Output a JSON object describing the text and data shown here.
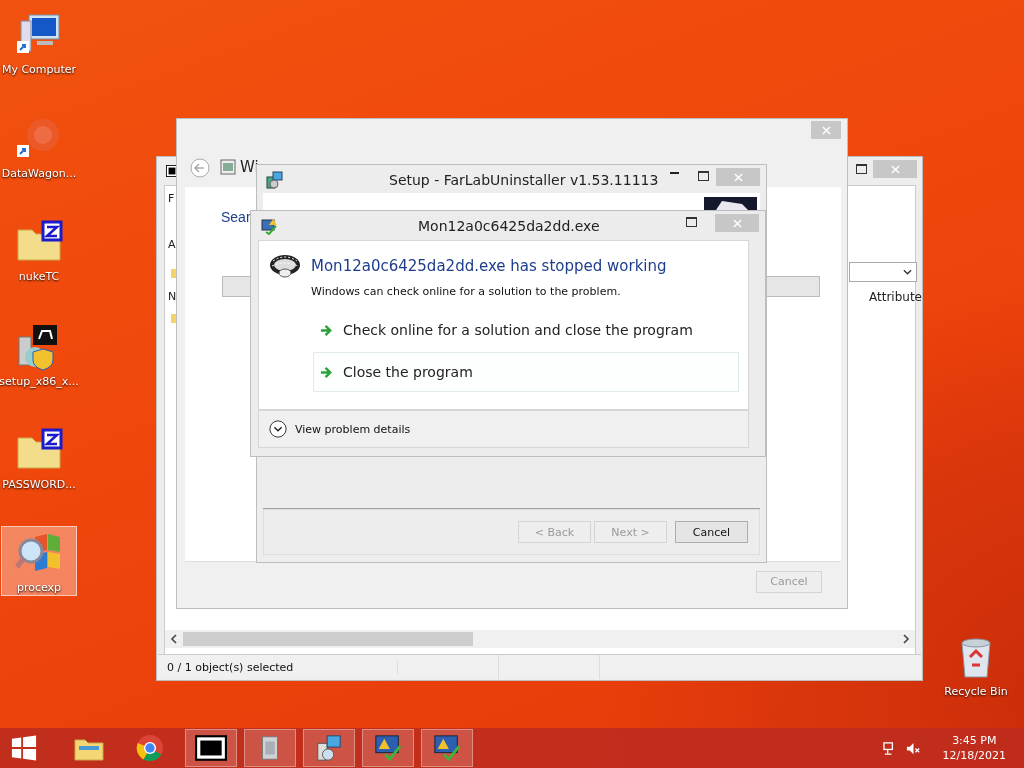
{
  "desktop_icons": [
    {
      "label": "My Computer",
      "kind": "computer",
      "selected": false
    },
    {
      "label": "DataWagon...",
      "kind": "blur",
      "selected": false
    },
    {
      "label": "nukeTC",
      "kind": "zipfolder",
      "selected": false
    },
    {
      "label": "setup_x86_x...",
      "kind": "installer",
      "selected": false
    },
    {
      "label": "PASSWORD...",
      "kind": "zipfolder",
      "selected": false
    },
    {
      "label": "procexp",
      "kind": "magnifier",
      "selected": true
    }
  ],
  "recycle_bin": {
    "label": "Recycle Bin"
  },
  "archive_window": {
    "menu_letter": "F",
    "address_letter": "A",
    "column_1": "N",
    "column_2": "Attribute",
    "status": "0 / 1 object(s) selected"
  },
  "features_window": {
    "title": "Wi",
    "heading": "Sear",
    "button": {
      "label": "Cancel",
      "disabled": true
    }
  },
  "setup_window": {
    "title": "Setup - FarLabUninstaller v1.53.11113",
    "buttons": [
      {
        "label": "< Back",
        "disabled": true
      },
      {
        "label": "Next >",
        "disabled": true
      },
      {
        "label": "Cancel",
        "disabled": false
      }
    ]
  },
  "error_dialog": {
    "title": "Mon12a0c6425da2dd.exe",
    "heading": "Mon12a0c6425da2dd.exe has stopped working",
    "message": "Windows can check online for a solution to the problem.",
    "options": [
      {
        "label": "Check online for a solution and close the program",
        "selected": false
      },
      {
        "label": "Close the program",
        "selected": true
      }
    ],
    "details_link": "View problem details"
  },
  "taskbar": {
    "apps": [
      {
        "kind": "folder",
        "open": false
      },
      {
        "kind": "chrome",
        "open": false
      },
      {
        "kind": "archive",
        "open": true
      },
      {
        "kind": "package",
        "open": true
      },
      {
        "kind": "setup",
        "open": true
      },
      {
        "kind": "alert",
        "open": true
      },
      {
        "kind": "alert",
        "open": true
      }
    ],
    "time": "3:45 PM",
    "date": "12/18/2021"
  }
}
